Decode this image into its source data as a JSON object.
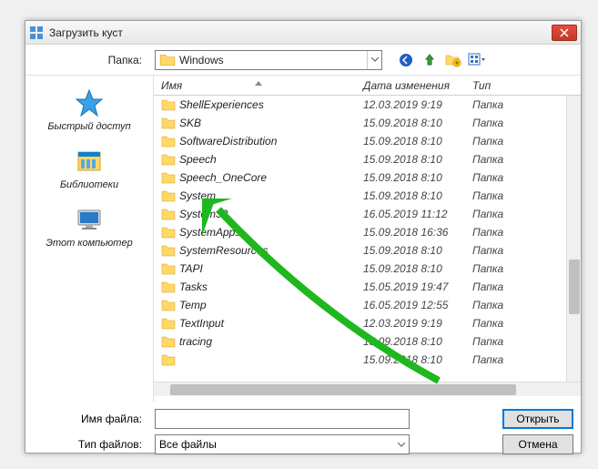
{
  "window": {
    "title": "Загрузить куст"
  },
  "toolbar": {
    "folder_label": "Папка:",
    "current_folder": "Windows"
  },
  "sidebar": {
    "items": [
      {
        "label": "Быстрый доступ"
      },
      {
        "label": "Библиотеки"
      },
      {
        "label": "Этот компьютер"
      }
    ]
  },
  "columns": {
    "name": "Имя",
    "date": "Дата изменения",
    "type": "Тип"
  },
  "rows": [
    {
      "name": "ShellExperiences",
      "date": "12.03.2019 9:19",
      "type": "Папка"
    },
    {
      "name": "SKB",
      "date": "15.09.2018 8:10",
      "type": "Папка"
    },
    {
      "name": "SoftwareDistribution",
      "date": "15.09.2018 8:10",
      "type": "Папка"
    },
    {
      "name": "Speech",
      "date": "15.09.2018 8:10",
      "type": "Папка"
    },
    {
      "name": "Speech_OneCore",
      "date": "15.09.2018 8:10",
      "type": "Папка"
    },
    {
      "name": "System",
      "date": "15.09.2018 8:10",
      "type": "Папка"
    },
    {
      "name": "System32",
      "date": "16.05.2019 11:12",
      "type": "Папка"
    },
    {
      "name": "SystemApps",
      "date": "15.09.2018 16:36",
      "type": "Папка"
    },
    {
      "name": "SystemResources",
      "date": "15.09.2018 8:10",
      "type": "Папка"
    },
    {
      "name": "TAPI",
      "date": "15.09.2018 8:10",
      "type": "Папка"
    },
    {
      "name": "Tasks",
      "date": "15.05.2019 19:47",
      "type": "Папка"
    },
    {
      "name": "Temp",
      "date": "16.05.2019 12:55",
      "type": "Папка"
    },
    {
      "name": "TextInput",
      "date": "12.03.2019 9:19",
      "type": "Папка"
    },
    {
      "name": "tracing",
      "date": "15.09.2018 8:10",
      "type": "Папка"
    },
    {
      "name": "",
      "date": "15.09.2018 8:10",
      "type": "Папка"
    }
  ],
  "bottom": {
    "filename_label": "Имя файла:",
    "filetype_label": "Тип файлов:",
    "filetype_value": "Все файлы",
    "open": "Открыть",
    "cancel": "Отмена"
  }
}
